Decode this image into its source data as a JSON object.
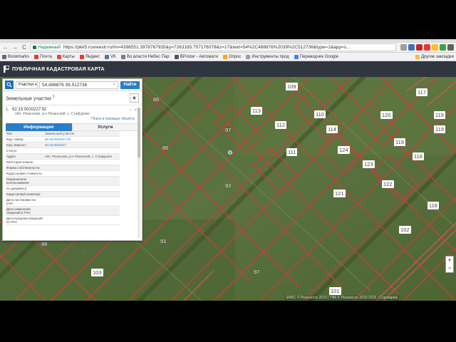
{
  "browser": {
    "secure_label": "Надежный",
    "url": "https://pkk5.rosreestr.ru/#x=4398551.3978767935&y=7263185.757176078&z=17&text=54%2C488876%2039%2C512736&type=1&app=s...",
    "bookmarks": [
      {
        "label": "Bookmarks",
        "color": "#6a6a6a"
      },
      {
        "label": "Почта",
        "color": "#d0442a"
      },
      {
        "label": "Карты",
        "color": "#e04a3a"
      },
      {
        "label": "Яндекс",
        "color": "#e33"
      },
      {
        "label": "VK",
        "color": "#4a76a8"
      },
      {
        "label": "Во власти Небес Пар",
        "color": "#7a7a7a"
      },
      {
        "label": "BPoster - Автомати",
        "color": "#555"
      },
      {
        "label": "Опрос",
        "color": "#f5a623"
      },
      {
        "label": "Инструменты прод",
        "color": "#9e9e9e"
      },
      {
        "label": "Переводчик Google",
        "color": "#4285f4"
      }
    ],
    "other_bookmarks": "Другие закладки"
  },
  "site": {
    "title": "ПУБЛИЧНАЯ КАДАСТРОВАЯ КАРТА"
  },
  "search": {
    "type_value": "Участки",
    "query": "54,488876 39,512736",
    "clear": "×",
    "find_label": "Найти"
  },
  "results": {
    "title": "Земельные участки",
    "count": "1",
    "item": {
      "num": "1.",
      "cadastral": "62:15:0020227:92",
      "address": "обл. Рязанская, р-н Рязанский, с. Стафурово",
      "link": "Поиск в границах объекта →",
      "icons": "☆ ✕"
    }
  },
  "tabs": {
    "info": "Информация",
    "services": "Услуги"
  },
  "info_rows": [
    {
      "key": "Тип:",
      "value": "Земельный участок",
      "link": false
    },
    {
      "key": "Кад. номер:",
      "value": "62:15:0020227:92",
      "link": true
    },
    {
      "key": "Кад. квартал:",
      "value": "62:15:0020227",
      "link": true
    },
    {
      "key": "Статус:",
      "value": "",
      "link": false
    },
    {
      "key": "Адрес:",
      "value": "обл. Рязанская, р-н Рязанский, с. Стафурово",
      "link": false
    },
    {
      "key": "Категория земель:",
      "value": "",
      "link": false
    },
    {
      "key": "Форма собственности:",
      "value": "",
      "link": false
    },
    {
      "key": "Кадастровая стоимость:",
      "value": "",
      "link": false
    },
    {
      "key": "Разрешенное использование:",
      "value": "",
      "link": false
    },
    {
      "key": "по документу:",
      "value": "",
      "link": false
    },
    {
      "key": "Кадастровый инженер:",
      "value": "",
      "link": false
    },
    {
      "key": "Дата постановки на учет:",
      "value": "",
      "link": false
    },
    {
      "key": "Дата изменения сведений в ГКН:",
      "value": "",
      "link": false
    },
    {
      "key": "Дата выгрузки сведений из ГКН:",
      "value": "",
      "link": false
    }
  ],
  "map": {
    "labels": [
      "109",
      "117",
      "86",
      "113",
      "110",
      "120",
      "119",
      "97",
      "112",
      "114",
      "124",
      "119",
      "86",
      "111",
      "118",
      "123",
      "92",
      "121",
      "122",
      "91",
      "102",
      "88",
      "97",
      "103",
      "101",
      "116"
    ],
    "highlight_labels": [
      "112",
      "120",
      "119",
      "124",
      "123",
      "114"
    ],
    "attribution": "ЕФКС © Росреестр 2010 | ГФК © Росреестр 2010-2015 | Сортеврем",
    "zoom_in": "+",
    "zoom_out": "−"
  }
}
